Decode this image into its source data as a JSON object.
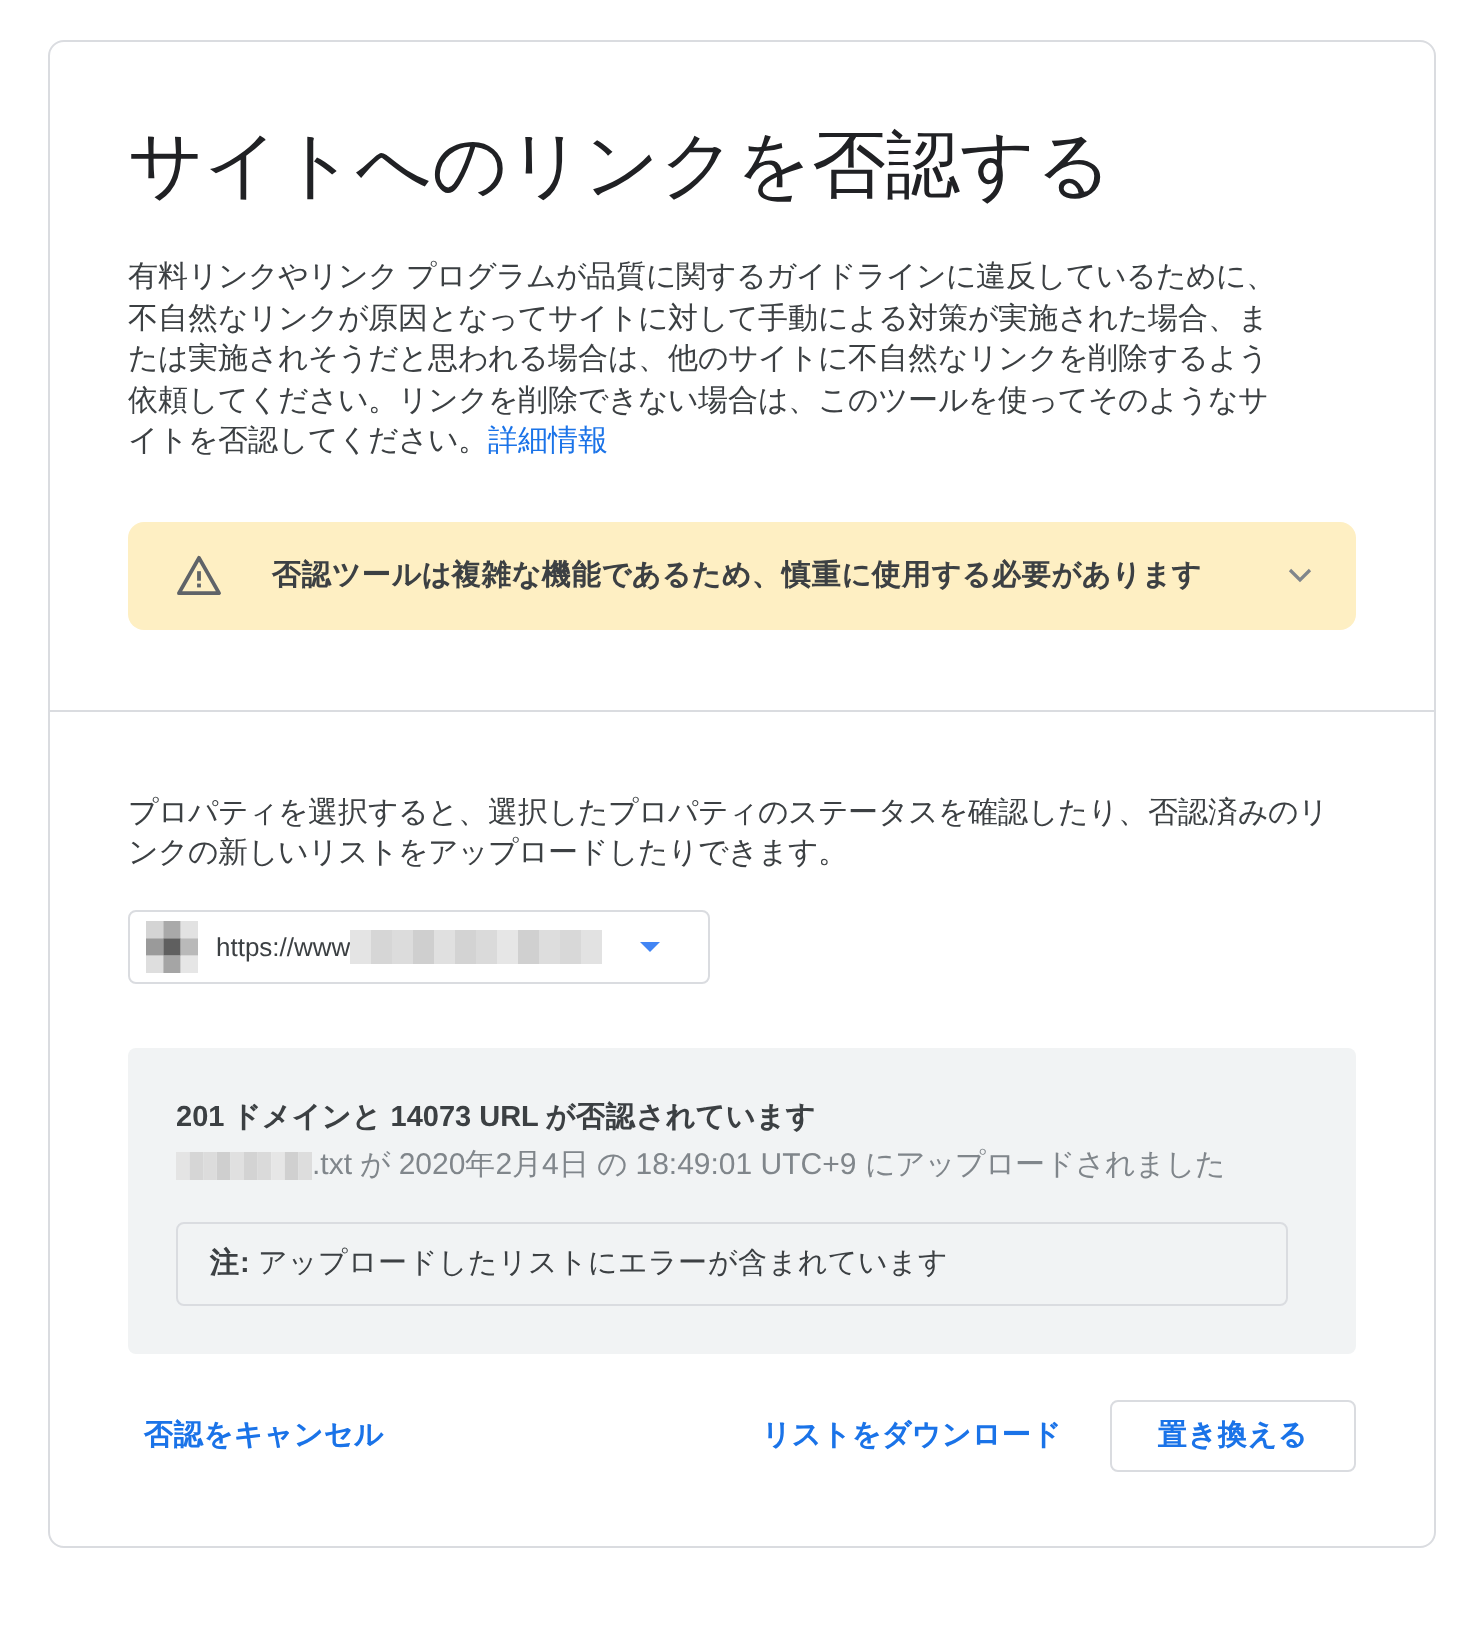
{
  "title": "サイトへのリンクを否認する",
  "intro": {
    "text": "有料リンクやリンク プログラムが品質に関するガイドラインに違反しているために、不自然なリンクが原因となってサイトに対して手動による対策が実施された場合、または実施されそうだと思われる場合は、他のサイトに不自然なリンクを削除するよう依頼してください。リンクを削除できない場合は、このツールを使ってそのようなサイトを否認してください。",
    "link": "詳細情報"
  },
  "warning": {
    "text": "否認ツールは複雑な機能であるため、慎重に使用する必要があります",
    "expanded": false
  },
  "property": {
    "description": "プロパティを選択すると、選択したプロパティのステータスを確認したり、否認済みのリンクの新しいリストをアップロードしたりできます。",
    "selector": {
      "value": "https://www"
    }
  },
  "status": {
    "summary": "201 ドメインと 14073 URL が否認されています",
    "upload_info": ".txt が 2020年2月4日 の 18:49:01 UTC+9 にアップロードされました",
    "note": "**注:** アップロードしたリストにエラーが含まれています"
  },
  "actions": [
    {
      "label": "否認をキャンセル",
      "kind": "text"
    },
    {
      "label": "リストをダウンロード",
      "kind": "text"
    },
    {
      "label": "置き換える",
      "kind": "outlined"
    }
  ]
}
